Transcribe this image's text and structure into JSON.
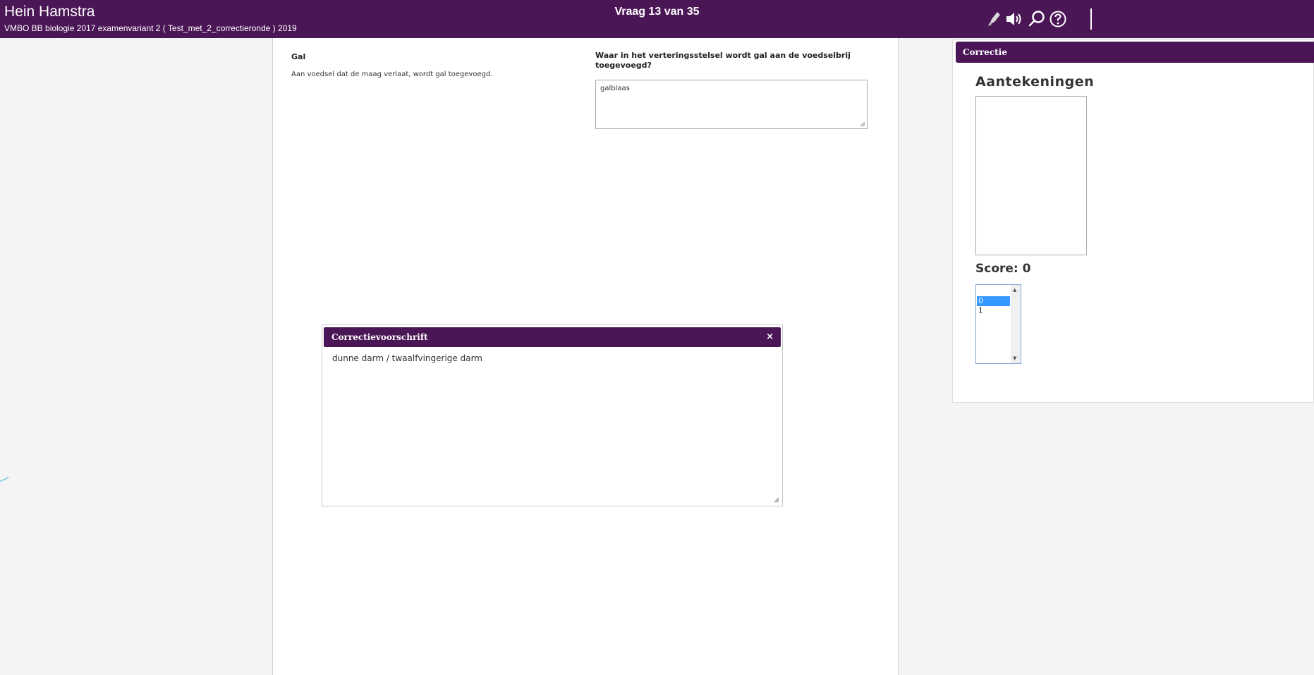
{
  "header": {
    "student_name": "Hein Hamstra",
    "exam_name": "VMBO BB biologie 2017 examenvariant 2 ( Test_met_2_correctieronde ) 2019",
    "question_counter": "Vraag 13 van 35",
    "tools": [
      "marker-icon",
      "speaker-icon",
      "search-icon",
      "help-icon"
    ]
  },
  "question": {
    "title": "Gal",
    "text": "Aan voedsel dat de maag verlaat, wordt gal toegevoegd.",
    "prompt": "Waar in het verteringsstelsel wordt gal aan de voedselbrij toegevoegd?",
    "answer": "galblaas"
  },
  "correction_dialog": {
    "title": "Correctievoorschrift",
    "close": "×",
    "body": "dunne darm / twaalfvingerige darm"
  },
  "correction_panel": {
    "title": "Correctie",
    "notes_label": "Aantekeningen",
    "score_label": "Score: 0",
    "score_options": [
      "0",
      "1"
    ],
    "selected_score": "0"
  },
  "colors": {
    "brand": "#4b1656",
    "selection": "#3399ff"
  }
}
